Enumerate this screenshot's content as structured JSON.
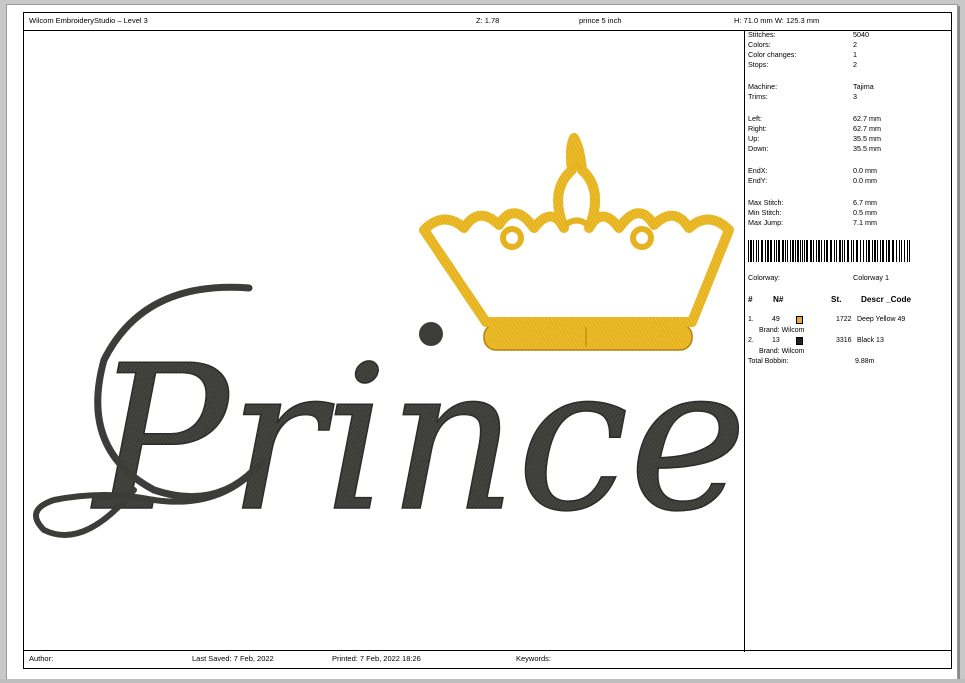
{
  "header": {
    "app_title": "Wilcom EmbroideryStudio – Level 3",
    "zoom": "Z: 1.78",
    "design_name": "prince 5 inch",
    "dimensions": "H: 71.0 mm   W: 125.3 mm"
  },
  "design": {
    "text": "Prince",
    "colors": {
      "crown": "#e6b320",
      "crown_dark": "#b08010",
      "text": "#3c3c38"
    }
  },
  "stats": [
    {
      "label": "Stitches:",
      "value": "5040"
    },
    {
      "label": "Colors:",
      "value": "2"
    },
    {
      "label": "Color changes:",
      "value": "1"
    },
    {
      "label": "Stops:",
      "value": "2"
    },
    {
      "label": "Machine:",
      "value": "Tajima"
    },
    {
      "label": "Trims:",
      "value": "3"
    },
    {
      "label": "Left:",
      "value": "62.7 mm"
    },
    {
      "label": "Right:",
      "value": "62.7 mm"
    },
    {
      "label": "Up:",
      "value": "35.5 mm"
    },
    {
      "label": "Down:",
      "value": "35.5 mm"
    },
    {
      "label": "EndX:",
      "value": "0.0 mm"
    },
    {
      "label": "EndY:",
      "value": "0.0 mm"
    },
    {
      "label": "Max Stitch:",
      "value": "6.7 mm"
    },
    {
      "label": "Min Stitch:",
      "value": "0.5 mm"
    },
    {
      "label": "Max Jump:",
      "value": "7.1 mm"
    }
  ],
  "colorway": {
    "label": "Colorway:",
    "value": "Colorway 1"
  },
  "table": {
    "headers": {
      "num": "#",
      "n": "N#",
      "st": "St.",
      "descr": "Descr _Code"
    },
    "rows": [
      {
        "idx": "1.",
        "n": "49",
        "st": "1722",
        "descr": "Deep Yellow 49",
        "brand": "Brand: Wilcom",
        "color": "#f0a820"
      },
      {
        "idx": "2.",
        "n": "13",
        "st": "3316",
        "descr": "Black 13",
        "brand": "Brand: Wilcom",
        "color": "#202020"
      }
    ],
    "total_label": "Total Bobbin:",
    "total_value": "9.88m"
  },
  "footer": {
    "author": "Author:",
    "last_saved": "Last Saved:  7 Feb, 2022",
    "printed": "Printed:  7 Feb, 2022 18:26",
    "keywords": "Keywords:"
  }
}
